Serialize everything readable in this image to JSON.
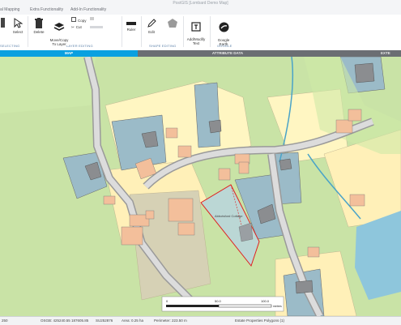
{
  "app": {
    "title": "PostGIS [Lombard Demo Map]"
  },
  "menu": {
    "tabs": [
      "al Mapping",
      "Extra Functionality",
      "Add-In Functionality"
    ]
  },
  "ribbon": {
    "select": "Select",
    "delete": "Delete",
    "move_copy": "Move/Copy\nTo Layer",
    "copy": "Copy",
    "cut": "Cut",
    "ruler": "Ruler",
    "edit": "Edit",
    "addmodify": "Add/Modify\nText",
    "google": "Google\nEarth",
    "groups": {
      "selecting": "SELECTING",
      "layer_editing": "LAYER EDITING",
      "shape_editing": "SHAPE EDITING",
      "google": "GOOGLE"
    }
  },
  "tabs": {
    "map": "MAP",
    "attribute": "ATTRIBUTE DATA",
    "ext": "EXTE"
  },
  "map": {
    "selected_label": "Abbotsford Cottage",
    "scalebar": {
      "zero": "0",
      "mid": "50.0",
      "end": "100.0",
      "unit": "metres"
    },
    "colors": {
      "field": "#c9e3a6",
      "yard": "#fff0b8",
      "garden": "#fff9c9",
      "road": "#9a9a9a",
      "building": "#f3bf9b",
      "dark": "#9bbbc8",
      "water": "#8ec6dc",
      "selection": "#e02020"
    }
  },
  "status": {
    "left": "250",
    "osgb": "OSGB: 425240.55  187605.85",
    "grid": "SU252876",
    "area": "Area: 0.25 ha",
    "perimeter": "Perimeter: 223.50 m",
    "layer": "Estate Properties Polygons (1)"
  }
}
